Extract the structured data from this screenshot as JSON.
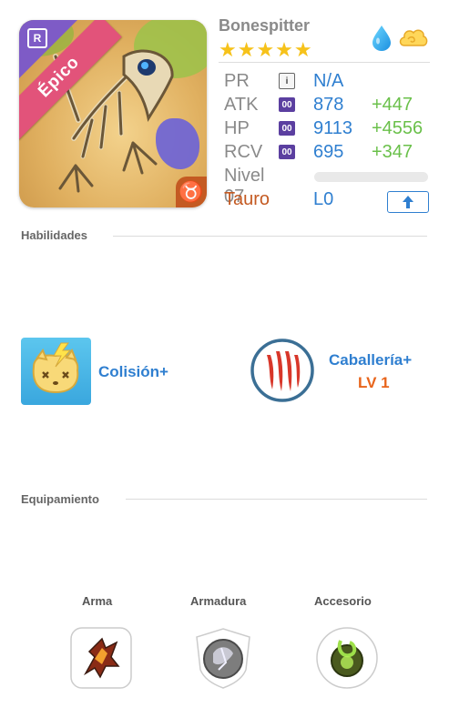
{
  "hero": {
    "name": "Bonespitter",
    "stars": "★★★★★",
    "rarity": "Épico",
    "rank_badge": "R",
    "zodiac_symbol": "♉",
    "elements": [
      "water-drop-icon",
      "wind-cloud-icon"
    ]
  },
  "stats": {
    "pr": {
      "label": "PR",
      "value": "N/A"
    },
    "atk": {
      "label": "ATK",
      "badge": "00",
      "value": "878",
      "bonus": "+447"
    },
    "hp": {
      "label": "HP",
      "badge": "00",
      "value": "9113",
      "bonus": "+4556"
    },
    "rcv": {
      "label": "RCV",
      "badge": "00",
      "value": "695",
      "bonus": "+347"
    },
    "level": {
      "label": "Nivel 07",
      "progress": 0
    },
    "sign": {
      "label": "Tauro",
      "value": "L0"
    }
  },
  "sections": {
    "skills_title": "Habilidades",
    "equipment_title": "Equipamiento"
  },
  "skills": [
    {
      "name": "Colisión+"
    },
    {
      "name": "Caballería+",
      "level": "LV 1"
    }
  ],
  "equipment": [
    {
      "label": "Arma"
    },
    {
      "label": "Armadura"
    },
    {
      "label": "Accesorio"
    }
  ],
  "colors": {
    "value_blue": "#2f7fd0",
    "bonus_green": "#6ac04a",
    "epic_pink": "#e2537a",
    "zodiac_orange": "#c45a22",
    "star_gold": "#f6c21a"
  }
}
